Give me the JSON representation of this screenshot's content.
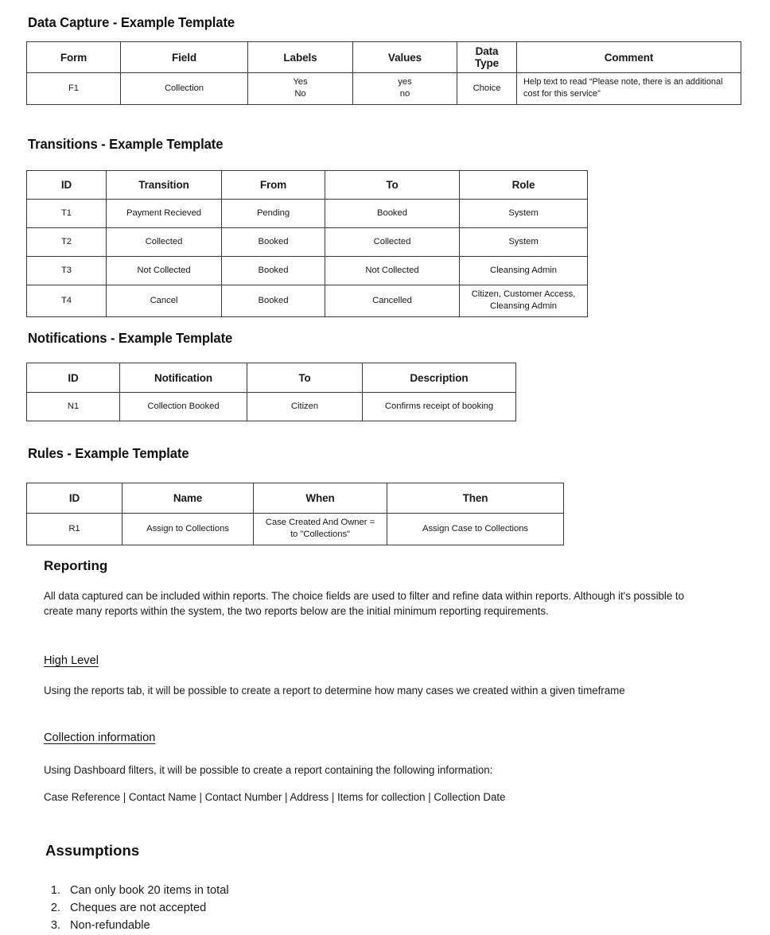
{
  "sections": {
    "data_capture": {
      "heading": "Data Capture - Example Template",
      "columns": [
        "Form",
        "Field",
        "Labels",
        "Values",
        "Data\nType",
        "Comment"
      ],
      "rows": [
        {
          "form": "F1",
          "field": "Collection",
          "labels": "Yes\nNo",
          "values": "yes\nno",
          "data_type": "Choice",
          "comment": "Help text to read “Please note, there is an additional cost for this service”"
        }
      ]
    },
    "transitions": {
      "heading": "Transitions - Example Template",
      "columns": [
        "ID",
        "Transition",
        "From",
        "To",
        "Role"
      ],
      "rows": [
        {
          "id": "T1",
          "transition": "Payment Recieved",
          "from": "Pending",
          "to": "Booked",
          "role": "System"
        },
        {
          "id": "T2",
          "transition": "Collected",
          "from": "Booked",
          "to": "Collected",
          "role": "System"
        },
        {
          "id": "T3",
          "transition": "Not Collected",
          "from": "Booked",
          "to": "Not Collected",
          "role": "Cleansing Admin"
        },
        {
          "id": "T4",
          "transition": "Cancel",
          "from": "Booked",
          "to": "Cancelled",
          "role": "Citizen, Customer Access,\nCleansing Admin"
        }
      ]
    },
    "notifications": {
      "heading": "Notifications - Example Template",
      "columns": [
        "ID",
        "Notification",
        "To",
        "Description"
      ],
      "rows": [
        {
          "id": "N1",
          "notification": "Collection Booked",
          "to": "Citizen",
          "description": "Confirms receipt of booking"
        }
      ]
    },
    "rules": {
      "heading": "Rules - Example Template",
      "columns": [
        "ID",
        "Name",
        "When",
        "Then"
      ],
      "rows": [
        {
          "id": "R1",
          "name": "Assign to Collections",
          "when": "Case Created And Owner =\nto \"Collections\"",
          "then": "Assign Case to Collections"
        }
      ]
    },
    "reporting": {
      "heading": "Reporting",
      "intro": "All data captured can be included within reports. The choice fields are used to filter and refine data within reports. Although it's possible to create many reports within the system, the two reports below are the initial minimum reporting requirements.",
      "high_level": {
        "heading": "High Level",
        "text": "Using the reports tab, it will be possible to create a report to determine how many cases we created within a given timeframe"
      },
      "collection_information": {
        "heading": "Collection information",
        "text": "Using Dashboard filters, it will be possible to create a report containing the following information:",
        "fields": "Case Reference | Contact Name | Contact Number | Address | Items for collection | Collection Date"
      }
    },
    "assumptions": {
      "heading": "Assumptions",
      "items": [
        "Can only book 20 items in total",
        "Cheques are not accepted",
        "Non-refundable"
      ]
    }
  },
  "colors": {
    "text": "#1a1a1a",
    "border": "#3a3a3a",
    "background": "#ffffff"
  }
}
